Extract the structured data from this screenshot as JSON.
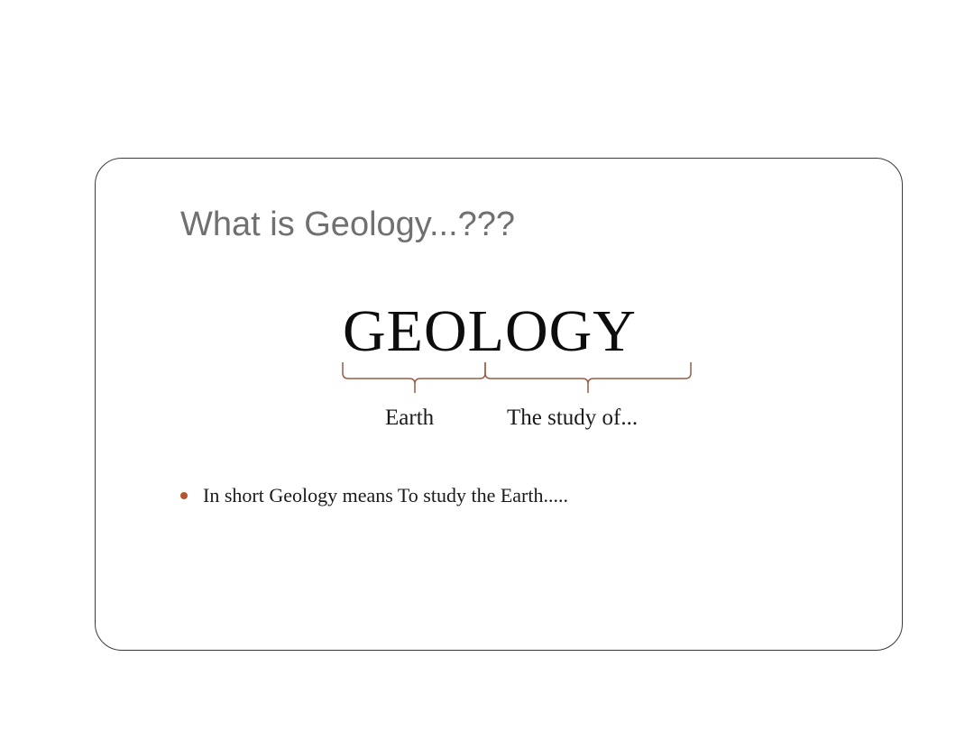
{
  "slide": {
    "title": "What is Geology...???",
    "word": "GEOLOGY",
    "parts": [
      {
        "label": "Earth"
      },
      {
        "label": "The study of..."
      }
    ],
    "bullets": [
      {
        "text": "In short Geology means To study the Earth....."
      }
    ]
  },
  "colors": {
    "title": "#707070",
    "accent": "#b5552e",
    "brace": "#9a5a44",
    "text": "#1a1a1a",
    "border": "#3a3a3a"
  }
}
